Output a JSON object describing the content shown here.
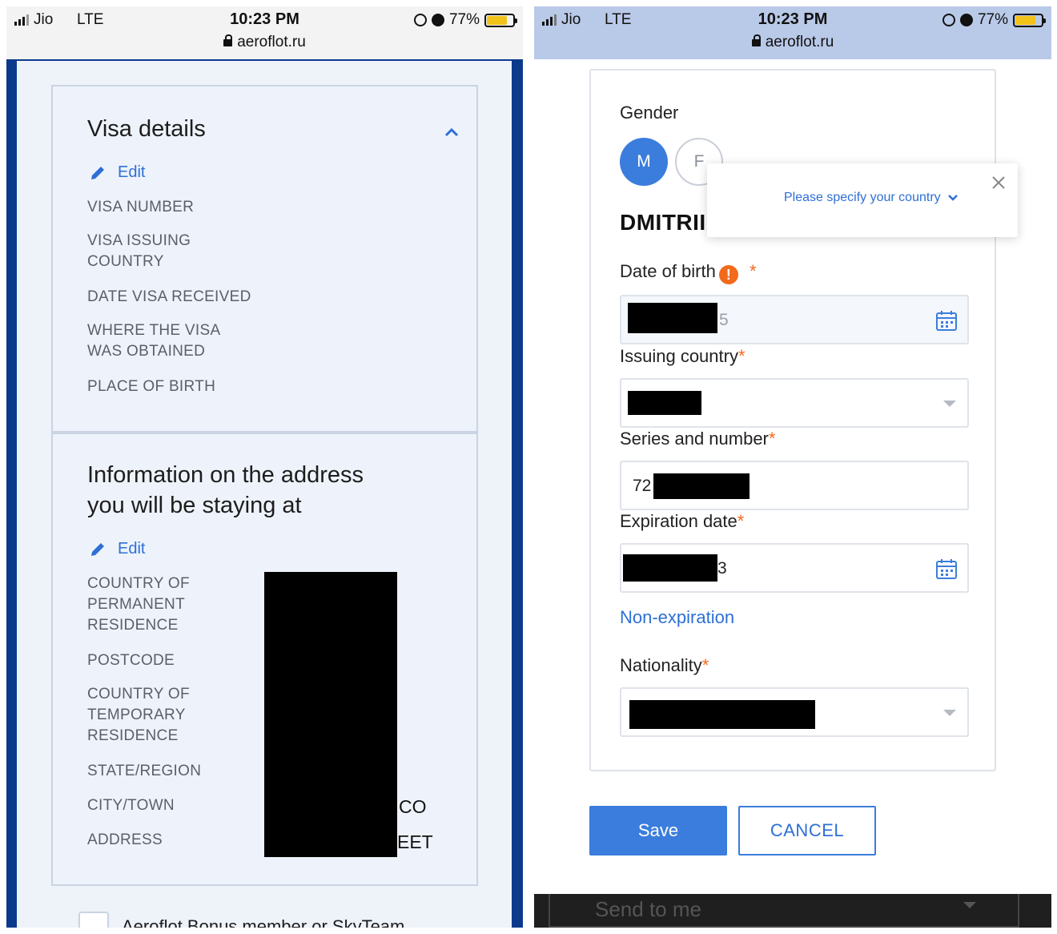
{
  "status_bar": {
    "carrier": "Jio",
    "network": "LTE",
    "time": "10:23 PM",
    "url": "aeroflot.ru",
    "battery": "77%"
  },
  "left": {
    "visa": {
      "title": "Visa details",
      "edit_label": "Edit",
      "fields": [
        "VISA NUMBER",
        "VISA ISSUING\nCOUNTRY",
        "DATE VISA RECEIVED",
        "WHERE THE VISA\nWAS OBTAINED",
        "PLACE OF BIRTH"
      ]
    },
    "address": {
      "title_line1": "Information on the address",
      "title_line2": "you will be staying at",
      "edit_label": "Edit",
      "fields": [
        "COUNTRY OF\nPERMANENT\nRESIDENCE",
        "POSTCODE",
        "COUNTRY OF\nTEMPORARY\nRESIDENCE",
        "STATE/REGION",
        "CITY/TOWN",
        "ADDRESS"
      ],
      "city_tail": "CO",
      "address_tail": "EET"
    },
    "bonus_text": "Aeroflot Bonus member or SkyTeam"
  },
  "right": {
    "gender_label": "Gender",
    "gender_m": "M",
    "gender_f": "F",
    "name": "DMITRII",
    "tooltip_text": "Please specify your country",
    "dob_label": "Date of birth",
    "dob_tail": "5",
    "issuing_label": "Issuing country",
    "series_label": "Series and number",
    "series_prefix": "72",
    "expiration_label": "Expiration date",
    "expiration_tail": "3",
    "non_expiration": "Non-expiration",
    "nationality_label": "Nationality",
    "required_mark": "*",
    "save": "Save",
    "cancel": "CANCEL",
    "send_to": "Send to me"
  },
  "colors": {
    "accent": "#3b7ddd",
    "required": "#f26a1b",
    "left_frame": "#0b3a8c"
  }
}
